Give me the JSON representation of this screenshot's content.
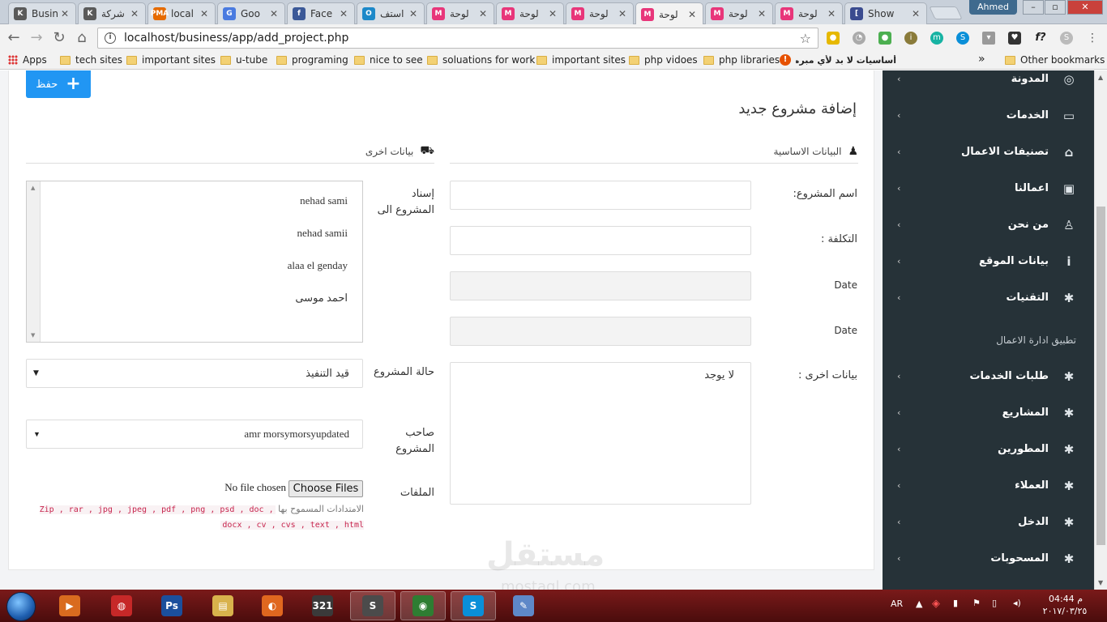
{
  "browser": {
    "tabs": [
      {
        "title": "Busin",
        "fav_color": "#5a5a5a",
        "fav_text": "K",
        "active": false
      },
      {
        "title": "شركة",
        "fav_color": "#5a5a5a",
        "fav_text": "K",
        "active": false
      },
      {
        "title": "local",
        "fav_color": "#e66b00",
        "fav_text": "PMA",
        "active": false
      },
      {
        "title": "Goo",
        "fav_color": "#4a7be0",
        "fav_text": "G",
        "active": false
      },
      {
        "title": "Face",
        "fav_color": "#3b5998",
        "fav_text": "f",
        "active": false
      },
      {
        "title": "استف",
        "fav_color": "#1d89c9",
        "fav_text": "O",
        "active": false
      },
      {
        "title": "لوحة",
        "fav_color": "#e8367a",
        "fav_text": "M",
        "active": false
      },
      {
        "title": "لوحة",
        "fav_color": "#e8367a",
        "fav_text": "M",
        "active": false
      },
      {
        "title": "لوحة",
        "fav_color": "#e8367a",
        "fav_text": "M",
        "active": false
      },
      {
        "title": "لوحة",
        "fav_color": "#e8367a",
        "fav_text": "M",
        "active": true
      },
      {
        "title": "لوحة",
        "fav_color": "#e8367a",
        "fav_text": "M",
        "active": false
      },
      {
        "title": "لوحة",
        "fav_color": "#e8367a",
        "fav_text": "M",
        "active": false
      },
      {
        "title": "Show",
        "fav_color": "#3a4b8f",
        "fav_text": "[",
        "active": false
      }
    ],
    "profile_name": "Ahmed",
    "url": "localhost/business/app/add_project.php"
  },
  "bookmarks": {
    "apps": "Apps",
    "items": [
      "tech sites",
      "important sites",
      "u-tube",
      "programing",
      "nice to see",
      "soluations for work",
      "important sites",
      "php vidoes",
      "php libraries"
    ],
    "arabic_item": "أساسيات لا بد لأي مبرمج مع",
    "more": "»",
    "other": "Other bookmarks"
  },
  "form": {
    "save_label": "حفظ",
    "title": "إضافة مشروع جديد",
    "basic_section": "البيانات الاساسية",
    "other_section": "بيانات اخرى",
    "project_name_label": "اسم المشروع:",
    "cost_label": "التكلفة :",
    "date_label_1": "Date",
    "date_label_2": "Date",
    "other_data_label": "بيانات اخرى :",
    "other_data_value": "لا يوجد",
    "assign_label": "إسناد المشروع الى",
    "assignees": [
      "nehad sami",
      "nehad samii",
      "alaa el genday",
      "احمد موسى"
    ],
    "status_label": "حالة المشروع",
    "status_value": "قيد التنفيذ",
    "owner_label": "صاحب المشروع",
    "owner_value": "amr morsymorsyupdated",
    "files_label": "الملفات",
    "no_file": "No file chosen",
    "choose_files": "Choose Files",
    "allowed_prefix": "الامتدادات المسموح بها",
    "allowed_exts": "Zip , rar , jpg , jpeg , pdf , png , psd , doc , docx , cv , cvs , text , html"
  },
  "sidebar": {
    "items": [
      {
        "label": "المدونة",
        "icon": "rss-icon",
        "glyph": "◎"
      },
      {
        "label": "الخدمات",
        "icon": "laptop-icon",
        "glyph": "▭"
      },
      {
        "label": "تصنيفات الاعمال",
        "icon": "tag-icon",
        "glyph": "⌂"
      },
      {
        "label": "اعمالنا",
        "icon": "briefcase-icon",
        "glyph": "▣"
      },
      {
        "label": "من نحن",
        "icon": "person-icon",
        "glyph": "♙"
      },
      {
        "label": "بيانات الموقع",
        "icon": "info-icon",
        "glyph": "i"
      },
      {
        "label": "التقنيات",
        "icon": "settings-icon",
        "glyph": "✱"
      }
    ],
    "group_title": "تطبيق ادارة الاعمال",
    "group_items": [
      {
        "label": "طلبات الخدمات",
        "icon": "settings-icon",
        "glyph": "✱"
      },
      {
        "label": "المشاريع",
        "icon": "settings-icon",
        "glyph": "✱"
      },
      {
        "label": "المطورين",
        "icon": "settings-icon",
        "glyph": "✱"
      },
      {
        "label": "العملاء",
        "icon": "settings-icon",
        "glyph": "✱"
      },
      {
        "label": "الدخل",
        "icon": "settings-icon",
        "glyph": "✱"
      },
      {
        "label": "المسحوبات",
        "icon": "settings-icon",
        "glyph": "✱"
      }
    ]
  },
  "watermark": {
    "text": "مستقل",
    "sub": "mostaql.com"
  },
  "taskbar": {
    "apps": [
      {
        "name": "media-player-icon",
        "color": "#d96b1f",
        "text": "▶"
      },
      {
        "name": "browser-globe-icon",
        "color": "#c62828",
        "text": "◍"
      },
      {
        "name": "photoshop-icon",
        "color": "#1b4f9c",
        "text": "Ps"
      },
      {
        "name": "file-explorer-icon",
        "color": "#d8b24c",
        "text": "▤"
      },
      {
        "name": "firefox-icon",
        "color": "#e0671f",
        "text": "◐"
      },
      {
        "name": "video-editor-icon",
        "color": "#3a3a3a",
        "text": "321"
      },
      {
        "name": "sublime-text-icon",
        "color": "#4b4b4b",
        "text": "S"
      },
      {
        "name": "chrome-icon",
        "color": "#2e7d32",
        "text": "◉"
      },
      {
        "name": "skype-icon",
        "color": "#0a8fd8",
        "text": "S"
      },
      {
        "name": "paint-icon",
        "color": "#5e88c8",
        "text": "✎"
      }
    ],
    "language": "AR",
    "time": "04:44 م",
    "date": "٢٠١٧/٠٣/٢٥"
  }
}
